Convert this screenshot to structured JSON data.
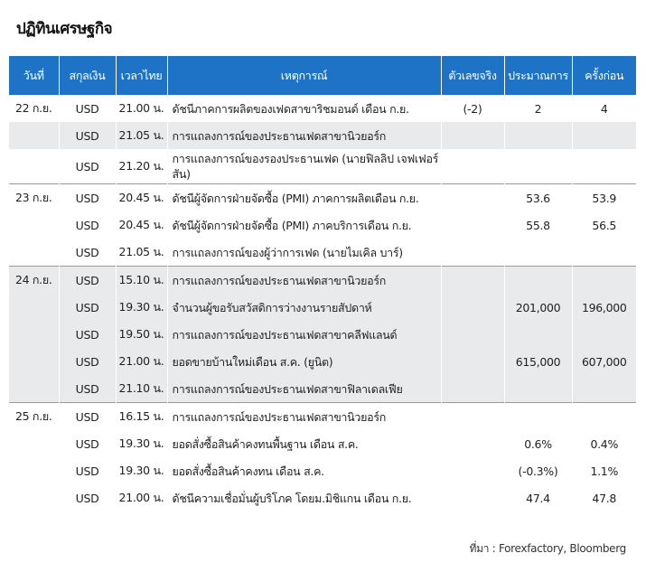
{
  "title": "ปฏิทินเศรษฐกิจ",
  "columns": [
    "วันที่",
    "สกุลเงิน",
    "เวลาไทย",
    "เหตุการณ์",
    "ตัวเลขจริง",
    "ประมาณการ",
    "ครั้งก่อน"
  ],
  "rows": [
    {
      "date": "22 ก.ย.",
      "currency": "USD",
      "time": "21.00 น.",
      "event": "ดัชนีภาคการผลิตของเฟดสาขาริชมอนด์ เดือน ก.ย.",
      "actual": "(-2)",
      "forecast": "2",
      "previous": "4"
    },
    {
      "date": "",
      "currency": "USD",
      "time": "21.05 น.",
      "event": "การแถลงการณ์ของประธานเฟดสาขานิวยอร์ก",
      "actual": "",
      "forecast": "",
      "previous": ""
    },
    {
      "date": "",
      "currency": "USD",
      "time": "21.20 น.",
      "event": "การแถลงการณ์ของรองประธานเฟด (นายฟิลลิป เจฟเฟอร์สัน)",
      "actual": "",
      "forecast": "",
      "previous": ""
    },
    {
      "date": "23 ก.ย.",
      "currency": "USD",
      "time": "20.45 น.",
      "event": "ดัชนีผู้จัดการฝ่ายจัดซื้อ (PMI) ภาคการผลิตเดือน ก.ย.",
      "actual": "",
      "forecast": "53.6",
      "previous": "53.9"
    },
    {
      "date": "",
      "currency": "USD",
      "time": "20.45 น.",
      "event": "ดัชนีผู้จัดการฝ่ายจัดซื้อ (PMI) ภาคบริการเดือน ก.ย.",
      "actual": "",
      "forecast": "55.8",
      "previous": "56.5"
    },
    {
      "date": "",
      "currency": "USD",
      "time": "21.05 น.",
      "event": "การแถลงการณ์ของผู้ว่าการเฟด (นายไมเคิล บาร์)",
      "actual": "",
      "forecast": "",
      "previous": ""
    },
    {
      "date": "24 ก.ย.",
      "currency": "USD",
      "time": "15.10 น.",
      "event": "การแถลงการณ์ของประธานเฟดสาขานิวยอร์ก",
      "actual": "",
      "forecast": "",
      "previous": ""
    },
    {
      "date": "",
      "currency": "USD",
      "time": "19.30 น.",
      "event": "จำนวนผู้ขอรับสวัสดิการว่างงานรายสัปดาห์",
      "actual": "",
      "forecast": "201,000",
      "previous": "196,000"
    },
    {
      "date": "",
      "currency": "USD",
      "time": "19.50 น.",
      "event": "การแถลงการณ์ของประธานเฟดสาขาคลีฟแลนด์",
      "actual": "",
      "forecast": "",
      "previous": ""
    },
    {
      "date": "",
      "currency": "USD",
      "time": "21.00 น.",
      "event": "ยอดขายบ้านใหม่เดือน ส.ค. (ยูนิต)",
      "actual": "",
      "forecast": "615,000",
      "previous": "607,000"
    },
    {
      "date": "",
      "currency": "USD",
      "time": "21.10 น.",
      "event": "การแถลงการณ์ของประธานเฟดสาขาฟิลาเดลเฟีย",
      "actual": "",
      "forecast": "",
      "previous": ""
    },
    {
      "date": "25 ก.ย.",
      "currency": "USD",
      "time": "16.15 น.",
      "event": "การแถลงการณ์ของประธานเฟดสาขานิวยอร์ก",
      "actual": "",
      "forecast": "",
      "previous": ""
    },
    {
      "date": "",
      "currency": "USD",
      "time": "19.30 น.",
      "event": "ยอดสั่งซื้อสินค้าคงทนพื้นฐาน เดือน ส.ค.",
      "actual": "",
      "forecast": "0.6%",
      "previous": "0.4%"
    },
    {
      "date": "",
      "currency": "USD",
      "time": "19.30 น.",
      "event": "ยอดสั่งซื้อสินค้าคงทน เดือน ส.ค.",
      "actual": "",
      "forecast": "(-0.3%)",
      "previous": "1.1%"
    },
    {
      "date": "",
      "currency": "USD",
      "time": "21.00 น.",
      "event": "ดัชนีความเชื่อมั่นผู้บริโภค โดยม.มิชิแกน เดือน ก.ย.",
      "actual": "",
      "forecast": "47.4",
      "previous": "47.8"
    }
  ],
  "source": "ที่มา : Forexfactory, Bloomberg",
  "colors": {
    "header_bg": "#1e73c6",
    "stripe": "#e9eaeb",
    "separator": "#9a9a9a"
  }
}
